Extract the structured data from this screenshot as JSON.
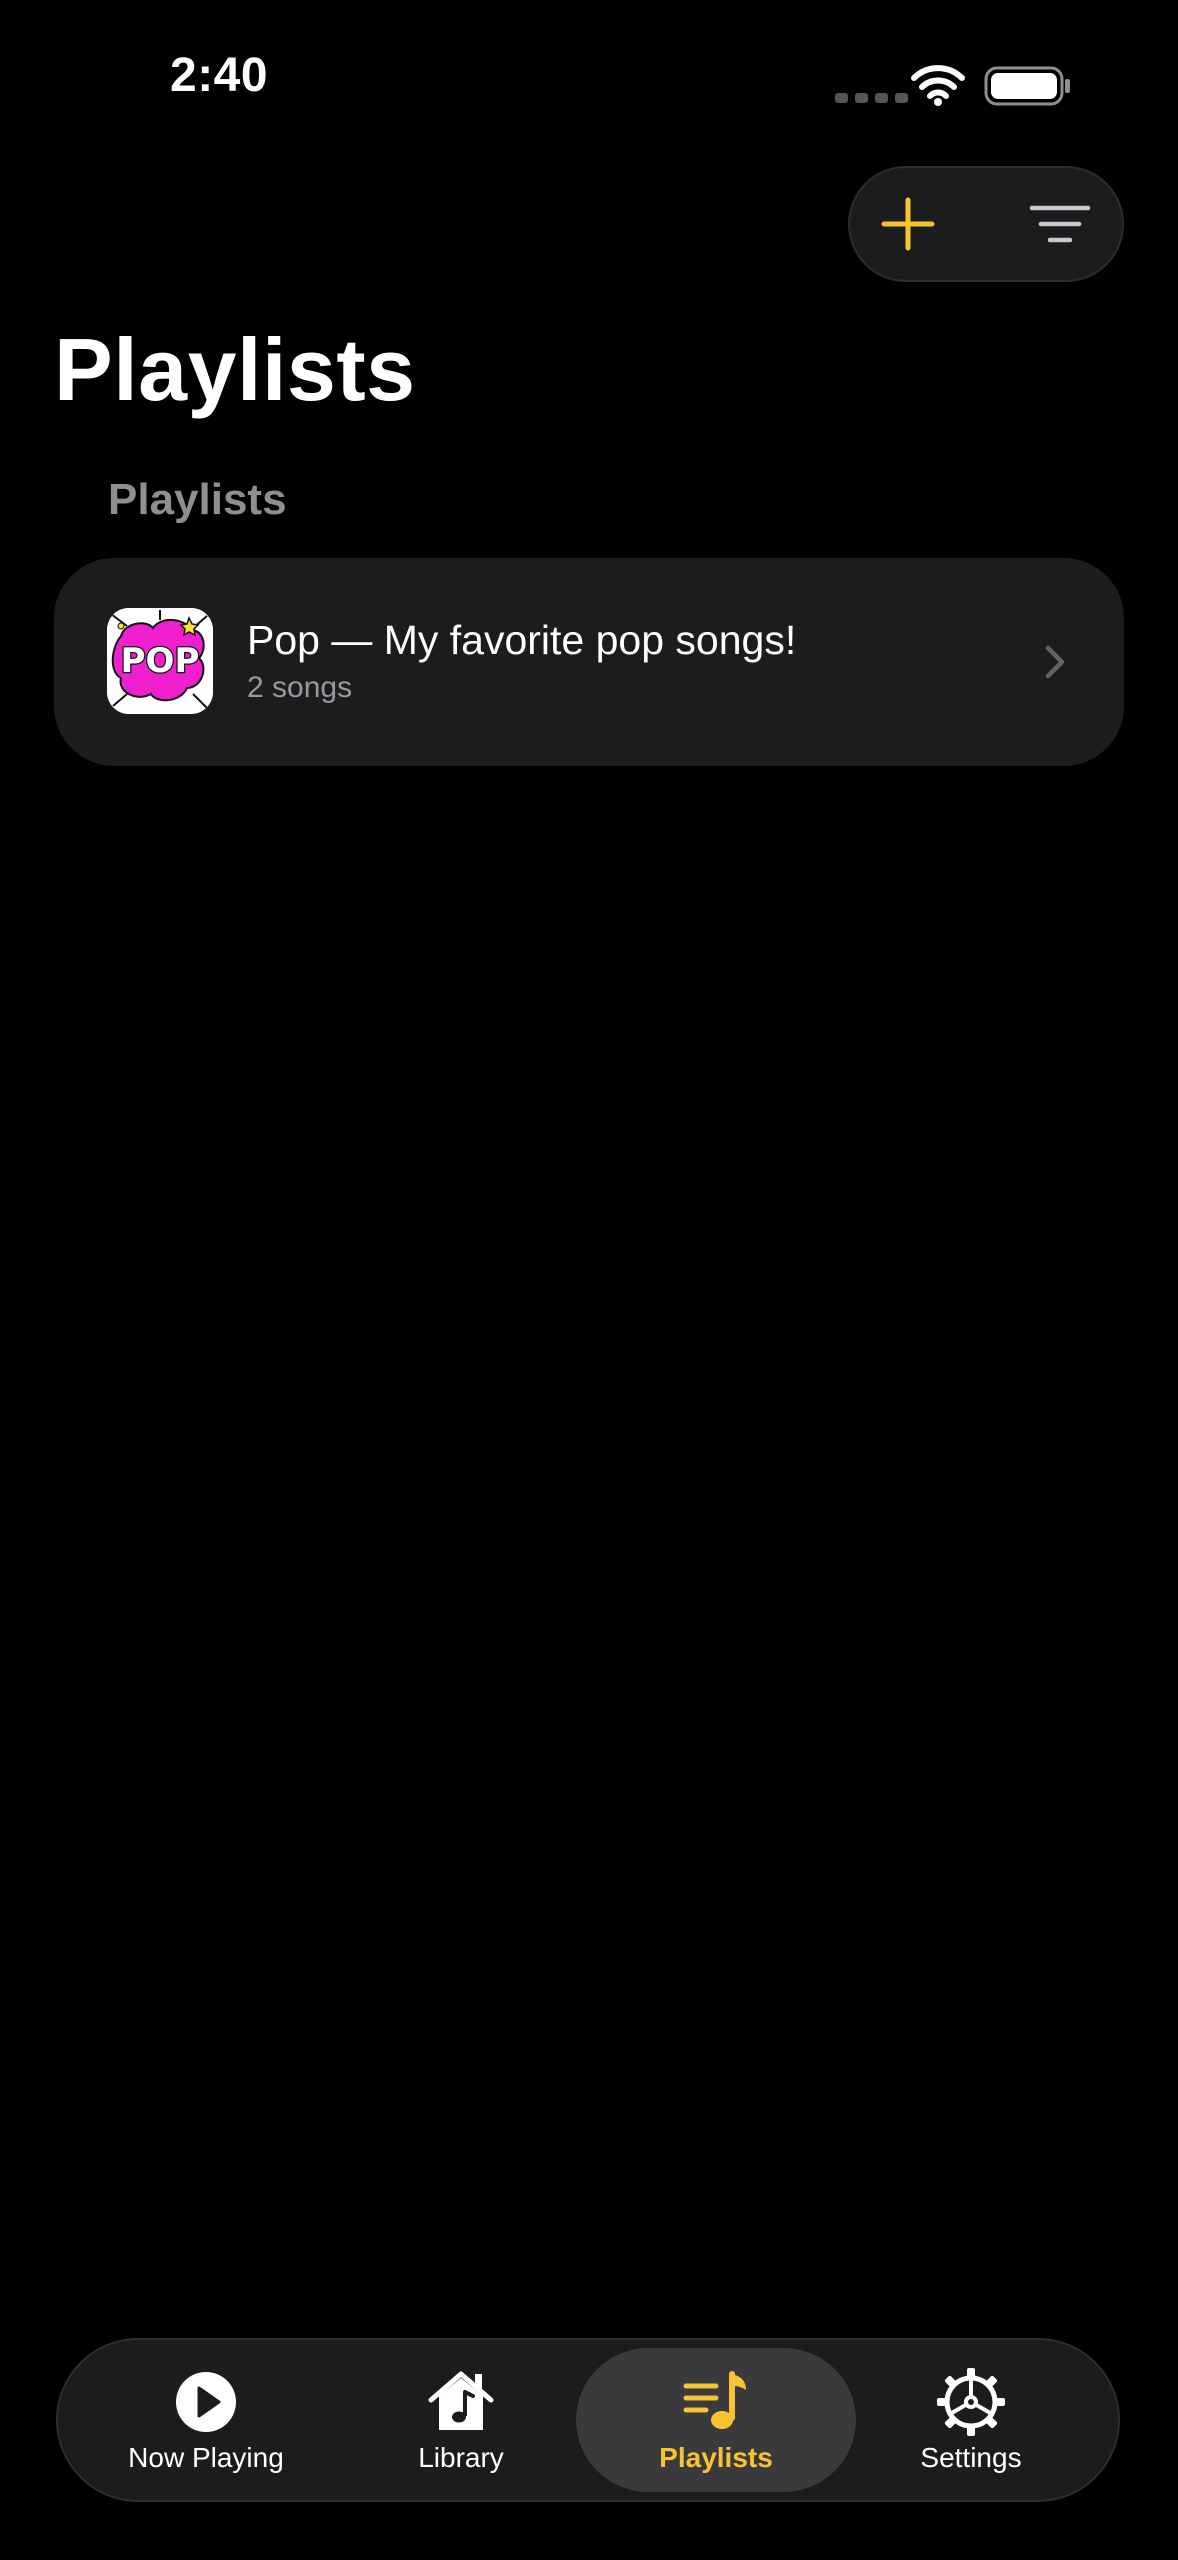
{
  "status_bar": {
    "time": "2:40"
  },
  "header": {
    "title": "Playlists",
    "add_icon": "plus-icon",
    "sort_icon": "sort-lines-icon"
  },
  "section": {
    "header": "Playlists"
  },
  "playlists": [
    {
      "title": "Pop — My favorite pop songs!",
      "subtitle": "2 songs",
      "artwork_icon": "pop-artwork"
    }
  ],
  "tab_bar": {
    "tabs": [
      {
        "label": "Now Playing",
        "icon": "play-circle-icon"
      },
      {
        "label": "Library",
        "icon": "house-music-icon"
      },
      {
        "label": "Playlists",
        "icon": "playlist-icon",
        "selected": true
      },
      {
        "label": "Settings",
        "icon": "gear-icon"
      }
    ]
  },
  "colors": {
    "accent": "#f6c431",
    "background": "#000000",
    "surface": "#1c1c1e",
    "secondary_text": "#8e8e93",
    "artwork_pink": "#ef1fd0"
  }
}
